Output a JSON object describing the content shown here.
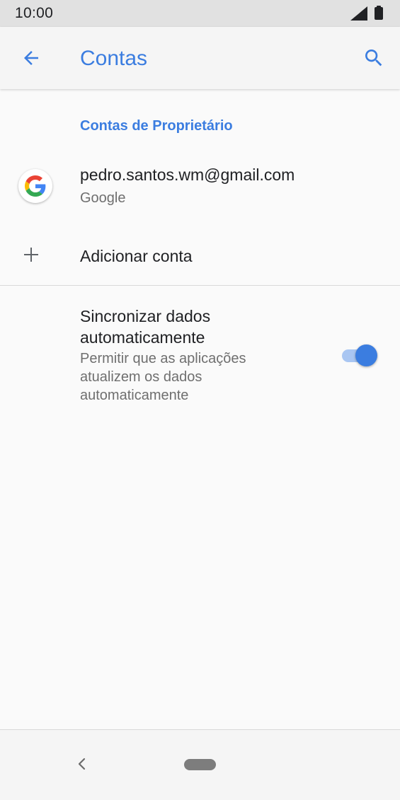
{
  "status_bar": {
    "time": "10:00",
    "icons": [
      "signal-icon",
      "battery-icon"
    ]
  },
  "app_bar": {
    "title": "Contas",
    "back_icon": "arrow-back-icon",
    "search_icon": "search-icon",
    "accent_color": "#3b7de0"
  },
  "owner_section": {
    "header": "Contas de Proprietário",
    "account": {
      "email": "pedro.santos.wm@gmail.com",
      "provider": "Google",
      "icon": "google-logo-icon"
    },
    "add_account": {
      "label": "Adicionar conta",
      "icon": "plus-icon"
    }
  },
  "sync": {
    "title": "Sincronizar dados automaticamente",
    "summary": "Permitir que as aplicações atualizem os dados automaticamente",
    "enabled": true
  },
  "nav_bar": {
    "icons": [
      "nav-back-icon",
      "nav-home-pill"
    ]
  }
}
